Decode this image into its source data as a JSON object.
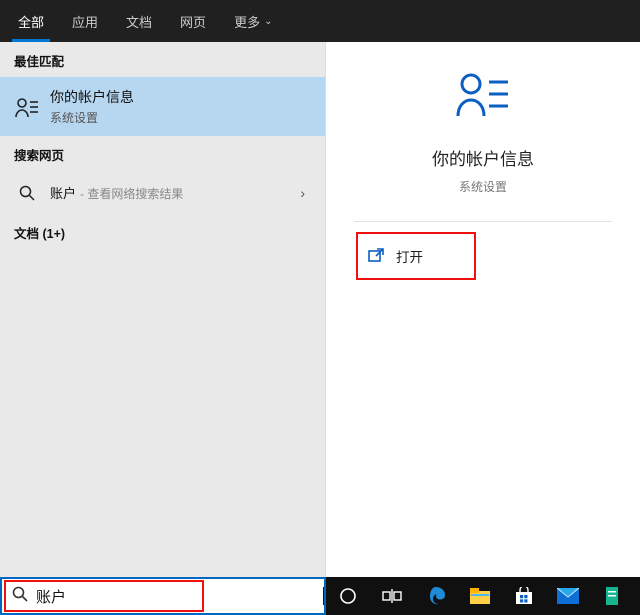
{
  "tabs": {
    "all": "全部",
    "apps": "应用",
    "docs": "文档",
    "web": "网页",
    "more": "更多"
  },
  "sections": {
    "best": "最佳匹配",
    "search_web": "搜索网页",
    "docs": "文档 (1+)"
  },
  "best_match": {
    "title": "你的帐户信息",
    "sub": "系统设置"
  },
  "web": {
    "term": "账户",
    "hint": "- 查看网络搜索结果"
  },
  "detail": {
    "title": "你的帐户信息",
    "sub": "系统设置",
    "open": "打开"
  },
  "search": {
    "value": "账户"
  }
}
